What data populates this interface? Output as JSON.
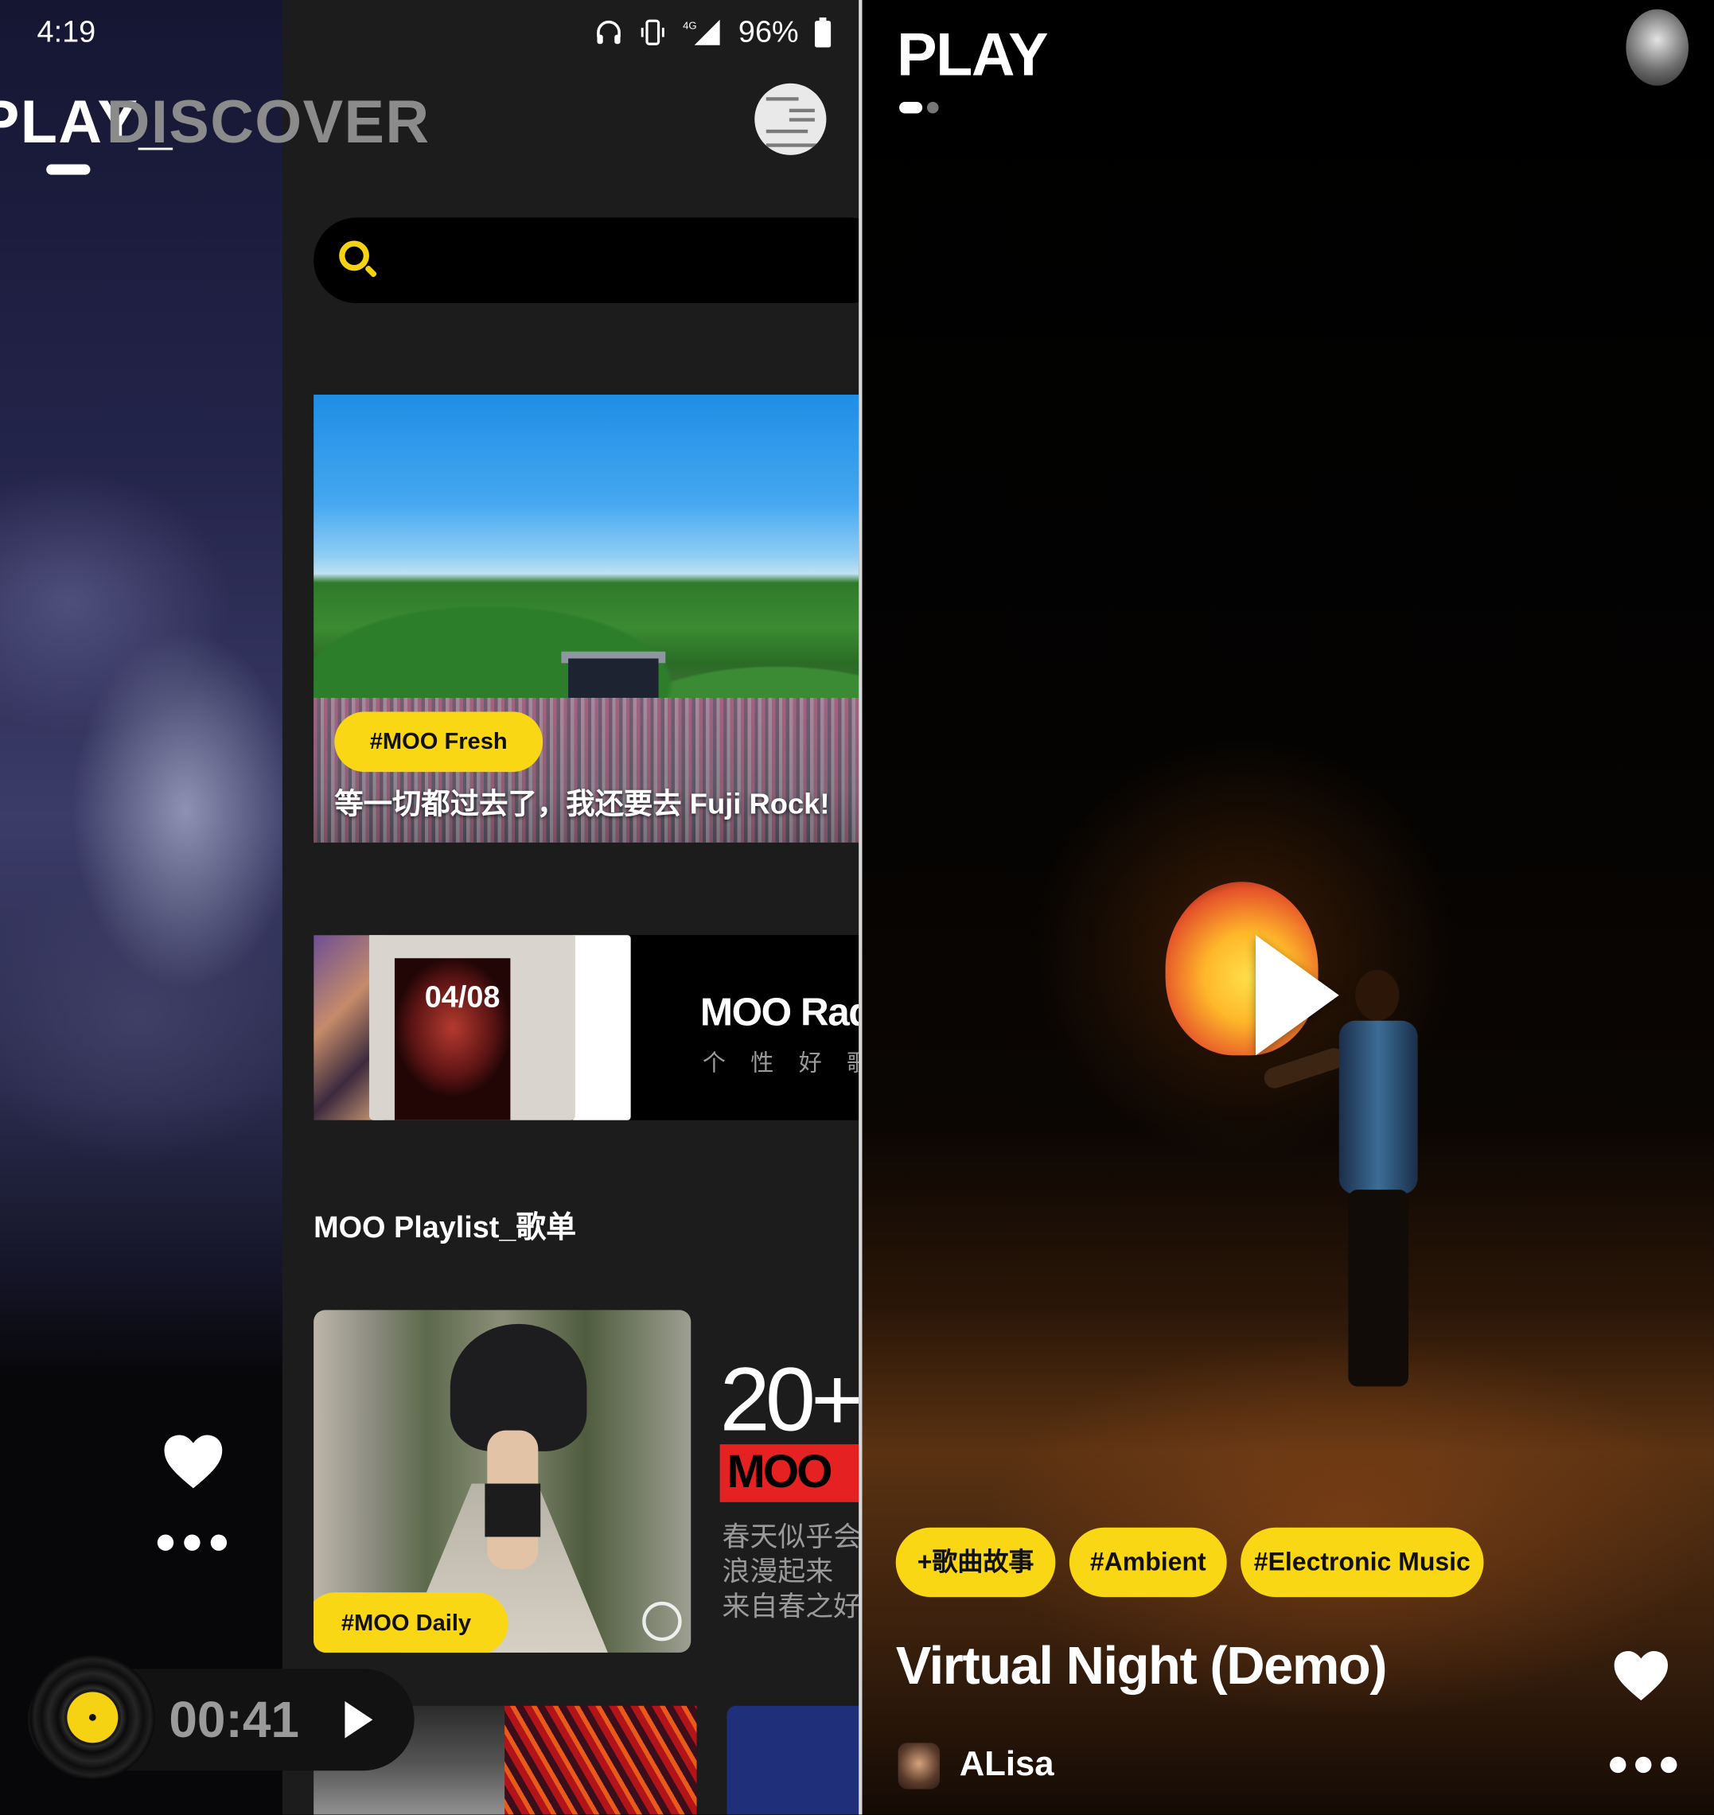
{
  "status_bar": {
    "time": "4:19",
    "network": "4G",
    "battery": "96%",
    "icons": [
      "headphones-icon",
      "vibrate-icon",
      "signal-icon",
      "battery-icon"
    ]
  },
  "tabs": [
    {
      "label": "PLAY_",
      "active": true
    },
    {
      "label": "DISCOVER",
      "active": false
    }
  ],
  "discover": {
    "search": {
      "placeholder": "",
      "icon": "search-icon"
    },
    "hero": {
      "tag": "#MOO Fresh",
      "title": "等一切都过去了，我还要去 Fuji Rock!"
    },
    "radio": {
      "date": "04/08",
      "title": "MOO Rad",
      "subtitle": "个 性 好 歌 推"
    },
    "section_title": "MOO Playlist_歌单",
    "playlist": {
      "tag": "#MOO Daily",
      "promo_number": "20+",
      "promo_brand": "MOO",
      "promo_lines": [
        "春天似乎会",
        "浪漫起来",
        "来自春之好"
      ]
    }
  },
  "mini_player": {
    "elapsed": "00:41",
    "play_icon": "play-icon"
  },
  "play": {
    "title": "PLAY",
    "tags": [
      "+歌曲故事",
      "#Ambient",
      "#Electronic Music"
    ],
    "song_title": "Virtual Night (Demo)",
    "artist": "ALisa"
  },
  "colors": {
    "accent": "#f9d714",
    "background": "#1c1c1c",
    "promo_red": "#e52121"
  }
}
